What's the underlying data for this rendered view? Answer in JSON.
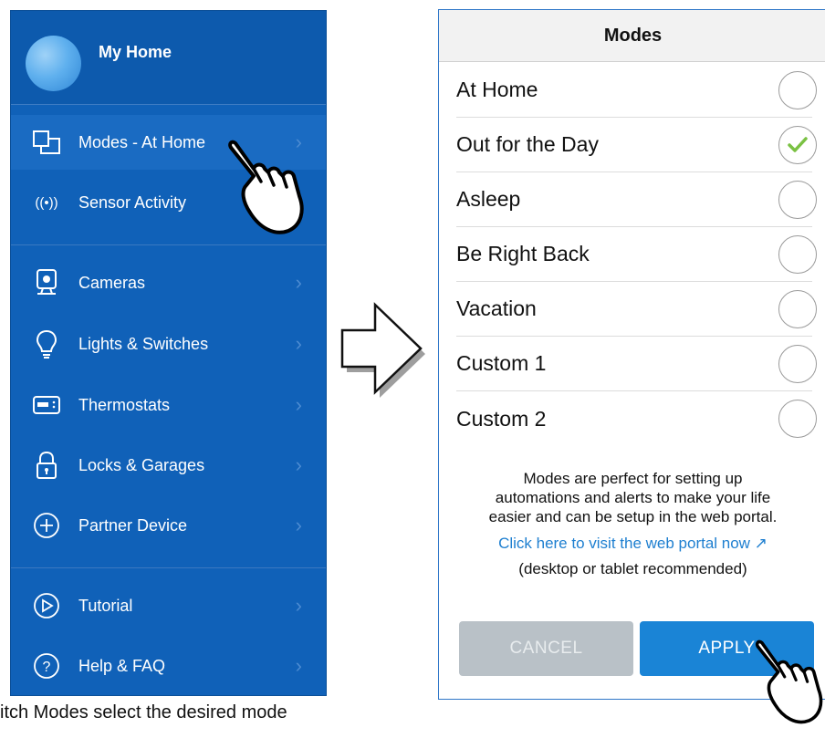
{
  "sidebar": {
    "home_title": "My Home",
    "items": [
      {
        "label": "Modes - At Home",
        "icon": "modes-icon",
        "chevron": "›"
      },
      {
        "label": "Sensor Activity",
        "icon": "sensor-icon",
        "chevron": ""
      },
      {
        "label": "Cameras",
        "icon": "camera-icon",
        "chevron": "›"
      },
      {
        "label": "Lights & Switches",
        "icon": "bulb-icon",
        "chevron": "›"
      },
      {
        "label": "Thermostats",
        "icon": "thermostat-icon",
        "chevron": "›"
      },
      {
        "label": "Locks & Garages",
        "icon": "lock-icon",
        "chevron": "›"
      },
      {
        "label": "Partner Device",
        "icon": "plus-circle-icon",
        "chevron": "›"
      },
      {
        "label": "Tutorial",
        "icon": "play-circle-icon",
        "chevron": "›"
      },
      {
        "label": "Help & FAQ",
        "icon": "help-circle-icon",
        "chevron": "›"
      }
    ]
  },
  "dialog": {
    "title": "Modes",
    "modes": [
      {
        "label": "At Home",
        "selected": false
      },
      {
        "label": "Out for the Day",
        "selected": true
      },
      {
        "label": "Asleep",
        "selected": false
      },
      {
        "label": "Be Right Back",
        "selected": false
      },
      {
        "label": "Vacation",
        "selected": false
      },
      {
        "label": "Custom 1",
        "selected": false
      },
      {
        "label": "Custom 2",
        "selected": false
      }
    ],
    "info_line1": "Modes are perfect for setting up",
    "info_line2": "automations and alerts to make your life",
    "info_line3": "easier and can be setup in the web portal.",
    "link_text": "Click here to visit the web portal now ↗",
    "link_sub": "(desktop or tablet recommended)",
    "cancel_label": "CANCEL",
    "apply_label": "APPLY"
  },
  "caption": "itch Modes select the desired mode",
  "colors": {
    "sidebar": "#1061b8",
    "accent": "#1a84d6",
    "check": "#7ac143"
  }
}
